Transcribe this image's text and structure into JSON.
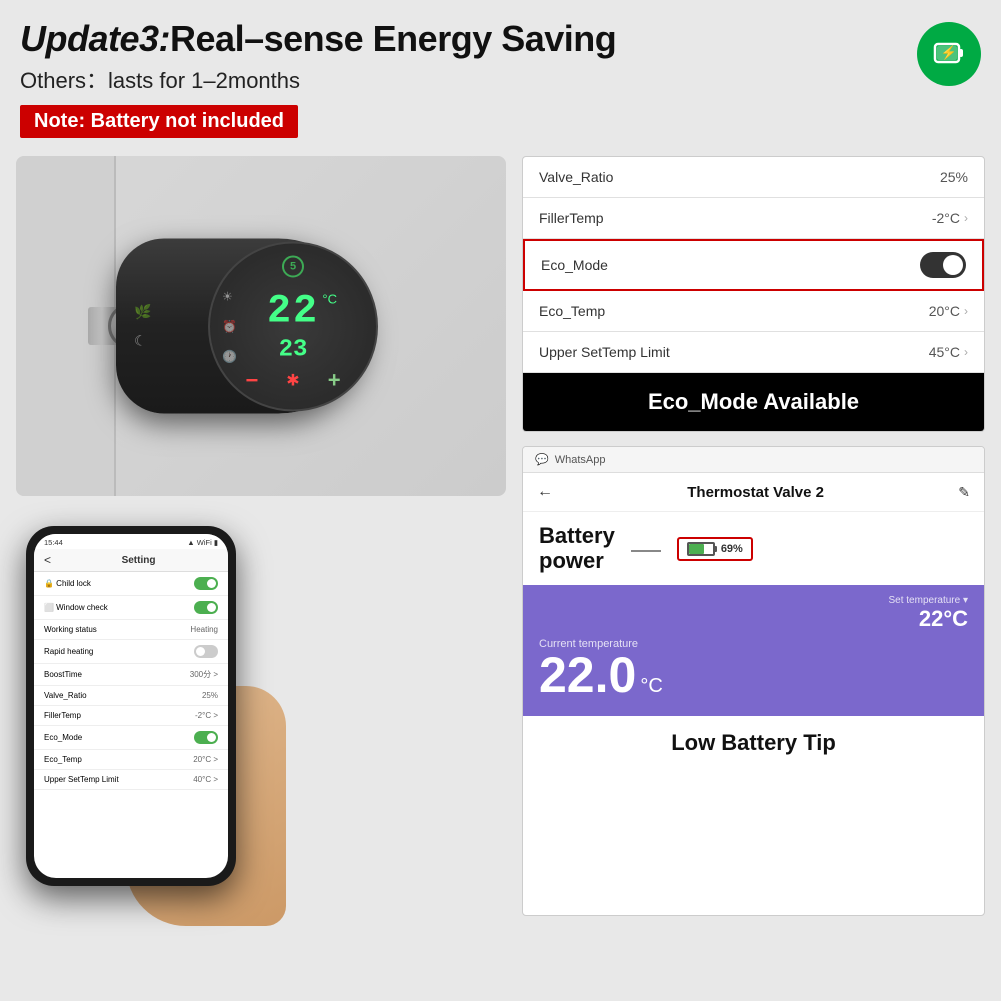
{
  "header": {
    "title_bold": "Update3:",
    "title_rest": "Real–sense Energy Saving",
    "subtitle": "Others：lasts for 1–2months",
    "note": "Note: Battery not included",
    "battery_icon_label": "battery-charging"
  },
  "eco_card": {
    "rows": [
      {
        "label": "Valve_Ratio",
        "value": "25%",
        "has_chevron": false
      },
      {
        "label": "FillerTemp",
        "value": "-2°C",
        "has_chevron": true
      },
      {
        "label": "Eco_Mode",
        "value": "toggle_on",
        "has_chevron": false,
        "highlighted": true
      },
      {
        "label": "Eco_Temp",
        "value": "20°C",
        "has_chevron": true
      },
      {
        "label": "Upper SetTemp Limit",
        "value": "45°C",
        "has_chevron": true
      }
    ],
    "mode_available_label": "Eco_Mode Available"
  },
  "battery_card": {
    "whatsapp_label": "WhatsApp",
    "app_title": "Thermostat Valve 2",
    "back_arrow": "←",
    "edit_icon": "✎",
    "battery_power_label_line1": "Battery",
    "battery_power_label_line2": "power",
    "battery_percentage": "69%",
    "set_temperature_label": "Set temperature ▾",
    "set_temperature_value": "22°C",
    "current_temperature_label": "Current temperature",
    "current_temperature_value": "22.0",
    "current_temperature_unit": "°C",
    "low_battery_tip_label": "Low Battery Tip"
  },
  "phone": {
    "time": "15:44",
    "status_icons": "▲▲ WiFi Batt",
    "nav_back": "<",
    "nav_title": "Setting",
    "settings_rows": [
      {
        "label": "Child lock",
        "value": "toggle_on"
      },
      {
        "label": "Window check",
        "value": "toggle_on"
      },
      {
        "label": "Working status",
        "value": "Heating"
      },
      {
        "label": "Rapid heating",
        "value": "toggle_off"
      },
      {
        "label": "BoostTime",
        "value": "300分 >"
      },
      {
        "label": "Valve_Ratio",
        "value": "25%"
      },
      {
        "label": "FillerTemp",
        "value": "-2°C >"
      },
      {
        "label": "Eco_Mode",
        "value": "toggle_eco"
      },
      {
        "label": "Eco_Temp",
        "value": "20°C >"
      },
      {
        "label": "Upper SetTemp Limit",
        "value": "40°C >"
      }
    ]
  },
  "thermostat": {
    "temp_main": "22",
    "temp_unit": "°C",
    "temp_secondary": "23",
    "top_number": "5"
  }
}
